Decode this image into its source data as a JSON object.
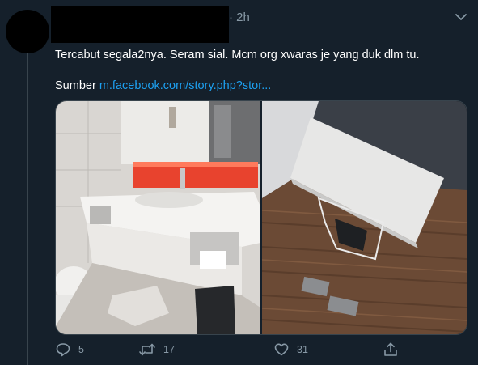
{
  "tweet": {
    "time": "· 2h",
    "text": "Tercabut segala2nya. Seram sial. Mcm org xwaras je yang duk dlm tu.",
    "source_label": "Sumber",
    "source_link": "m.facebook.com/story.php?stor...",
    "media": [
      {
        "name": "bathroom-sink-photo"
      },
      {
        "name": "wall-panel-photo"
      }
    ],
    "actions": {
      "reply_count": "5",
      "retweet_count": "17",
      "like_count": "31"
    }
  },
  "icons": {
    "more": "chevron-down-icon",
    "reply": "speech-bubble-icon",
    "retweet": "retweet-arrows-icon",
    "like": "heart-icon",
    "share": "share-upload-icon"
  },
  "colors": {
    "background": "#15202b",
    "text": "#ffffff",
    "muted": "#8899a6",
    "link": "#1da1f2",
    "border": "#38444d"
  }
}
